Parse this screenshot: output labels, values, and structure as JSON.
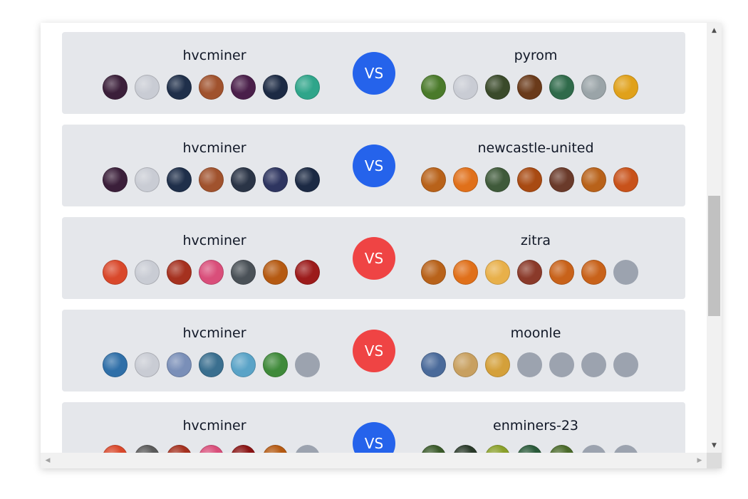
{
  "vs_label": "VS",
  "matches": [
    {
      "player": "hvcminer",
      "opponent": "pyrom",
      "result": "win",
      "player_heroes": [
        "hero-1",
        "hero-2",
        "hero-3",
        "hero-4",
        "hero-5",
        "hero-6",
        "hero-7"
      ],
      "opponent_heroes": [
        "hero-1",
        "hero-2",
        "hero-3",
        "hero-4",
        "hero-5",
        "hero-6",
        "hero-7"
      ]
    },
    {
      "player": "hvcminer",
      "opponent": "newcastle-united",
      "result": "win",
      "player_heroes": [
        "hero-1",
        "hero-2",
        "hero-3",
        "hero-4",
        "hero-5",
        "hero-6",
        "hero-7"
      ],
      "opponent_heroes": [
        "hero-1",
        "hero-2",
        "hero-3",
        "hero-4",
        "hero-5",
        "hero-6",
        "hero-7"
      ]
    },
    {
      "player": "hvcminer",
      "opponent": "zitra",
      "result": "loss",
      "player_heroes": [
        "hero-1",
        "hero-2",
        "hero-3",
        "hero-4",
        "hero-5",
        "hero-6",
        "hero-7"
      ],
      "opponent_heroes": [
        "hero-1",
        "hero-2",
        "hero-3",
        "hero-4",
        "hero-5",
        "hero-6",
        "empty"
      ]
    },
    {
      "player": "hvcminer",
      "opponent": "moonle",
      "result": "loss",
      "player_heroes": [
        "hero-1",
        "hero-2",
        "hero-3",
        "hero-4",
        "hero-5",
        "hero-6",
        "empty"
      ],
      "opponent_heroes": [
        "hero-1",
        "hero-2",
        "hero-3",
        "empty",
        "empty",
        "empty",
        "empty"
      ]
    },
    {
      "player": "hvcminer",
      "opponent": "enminers-23",
      "result": "win",
      "player_heroes": [
        "hero-1",
        "hero-2",
        "hero-3",
        "hero-4",
        "hero-5",
        "hero-6",
        "empty"
      ],
      "opponent_heroes": [
        "hero-1",
        "hero-2",
        "hero-3",
        "hero-4",
        "hero-5",
        "empty",
        "empty"
      ]
    }
  ],
  "avatar_colors": {
    "0": [
      "#3b1f3a",
      "#c9ccd4",
      "#1f2f4a",
      "#a0522d",
      "#4a1f4a",
      "#1c2a44",
      "#2fa58a"
    ],
    "1": [
      "#3b1f3a",
      "#c9ccd4",
      "#1f2f4a",
      "#a0522d",
      "#2a3446",
      "#2e3560",
      "#1c2a44"
    ],
    "2": [
      "#d9482b",
      "#c9ccd4",
      "#a5311f",
      "#d94e7a",
      "#4a5157",
      "#b55a12",
      "#9c1b1b"
    ],
    "3": [
      "#2f6fa8",
      "#c9ccd4",
      "#7a8fb8",
      "#3a6f8f",
      "#5aa3c7",
      "#3f8a3a",
      "empty"
    ],
    "4": [
      "#d9482b",
      "#5a5a5a",
      "#a5311f",
      "#d94e7a",
      "#8a1414",
      "#b55a12",
      "empty"
    ],
    "o0": [
      "#4a7a2a",
      "#c9ccd4",
      "#3a4a2a",
      "#6a3a1a",
      "#2f6a4a",
      "#9aa4a8",
      "#e0a11a"
    ],
    "o1": [
      "#b8621a",
      "#e0701a",
      "#3f5a3a",
      "#a84a12",
      "#6a3a2a",
      "#b8621a",
      "#c8521a"
    ],
    "o2": [
      "#b8621a",
      "#e0701a",
      "#e8b04a",
      "#8a3a2a",
      "#c8621a",
      "#c8621a",
      "empty"
    ],
    "o3": [
      "#4a6a9a",
      "#c8a060",
      "#d4a03a",
      "empty",
      "empty",
      "empty",
      "empty"
    ],
    "o4": [
      "#3a5a2a",
      "#2a3a2a",
      "#8aa02a",
      "#2a5a3a",
      "#4a6a2a",
      "empty",
      "empty"
    ]
  },
  "colors": {
    "win": "#2563eb",
    "loss": "#ef4444",
    "empty_slot": "#9ca3af",
    "card_bg": "#e5e7eb"
  }
}
